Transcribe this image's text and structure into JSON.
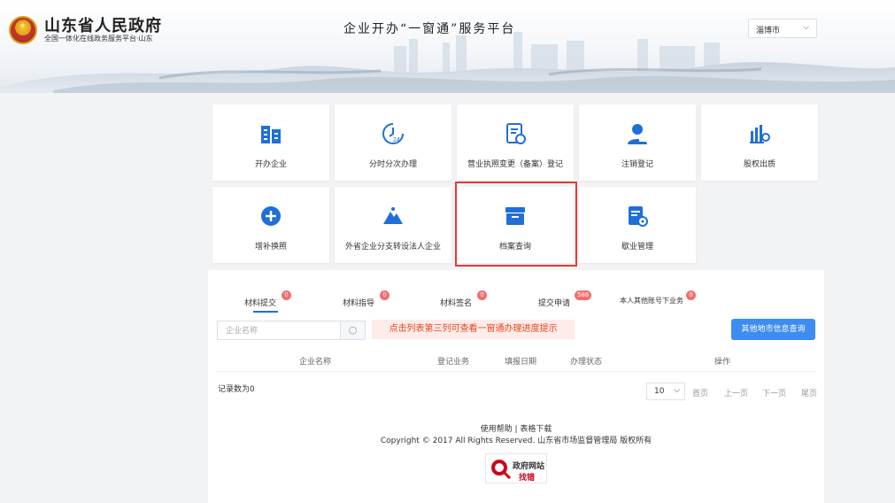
{
  "header": {
    "gov_title": "山东省人民政府",
    "gov_subtitle": "全国一体化在线政务服务平台·山东",
    "platform_title": "企业开办“一窗通”服务平台",
    "city_select": {
      "value": "淄博市"
    }
  },
  "services": [
    {
      "label": "开办企业",
      "icon": "building-icon"
    },
    {
      "label": "分时分次办理",
      "icon": "clock-24-icon"
    },
    {
      "label": "营业执照变更（备案）登记",
      "icon": "document-refresh-icon"
    },
    {
      "label": "注销登记",
      "icon": "user-card-icon"
    },
    {
      "label": "股权出质",
      "icon": "equity-chart-icon"
    },
    {
      "label": "增补换照",
      "icon": "plus-circle-icon"
    },
    {
      "label": "外省企业分支转设法人企业",
      "icon": "mountain-icon"
    },
    {
      "label": "档案查询",
      "icon": "archive-box-icon"
    },
    {
      "label": "歇业管理",
      "icon": "doc-gear-icon"
    }
  ],
  "tabs": [
    {
      "label": "材料提交",
      "count": "0"
    },
    {
      "label": "材料指导",
      "count": "0"
    },
    {
      "label": "材料签名",
      "count": "0"
    },
    {
      "label": "提交申请",
      "count": "586"
    },
    {
      "label": "本人其他账号下业务",
      "count": "0"
    }
  ],
  "search": {
    "placeholder": "企业名称",
    "value": ""
  },
  "hint": "点击列表第三列可查看一窗通办理进度提示",
  "other_city_button": "其他地市信息查询",
  "table": {
    "columns": [
      "企业名称",
      "登记业务",
      "填报日期",
      "办理状态",
      "操作"
    ],
    "record_count": "记录数为0"
  },
  "pagination": {
    "page_size": "10",
    "first": "首页",
    "prev": "上一页",
    "next": "下一页",
    "last": "尾页"
  },
  "footer": {
    "links": "使用帮助 | 表格下载",
    "copyright": "Copyright © 2017 All Rights Reserved. 山东省市场监督管理局 版权所有",
    "gov_site": "政府网站",
    "find_error": "找错"
  },
  "colors": {
    "primary": "#3d8cf0",
    "icon_blue": "#1e6fd9",
    "badge": "#f56c6c",
    "hint_text": "#e8451e",
    "highlight": "#e53935"
  }
}
